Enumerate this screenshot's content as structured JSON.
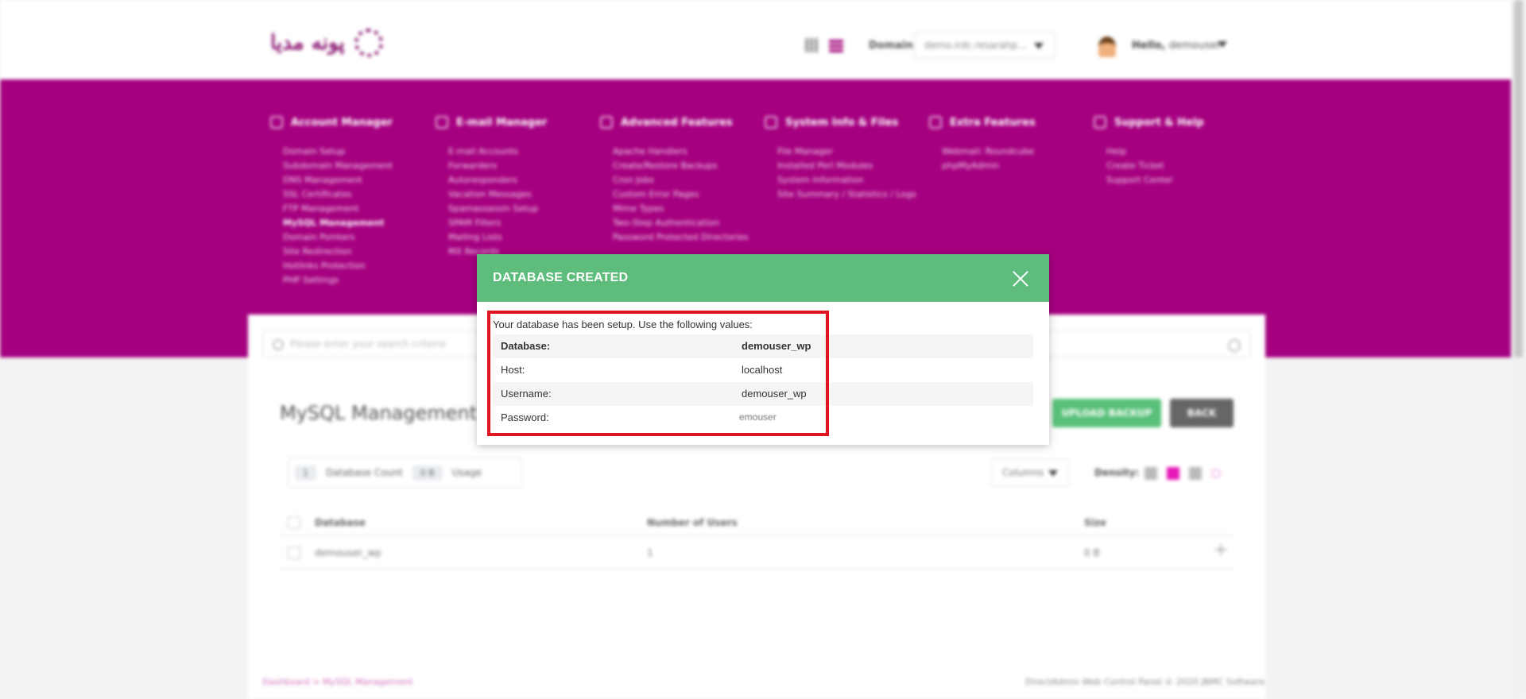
{
  "header": {
    "logo_text": "پونه مدیا",
    "domain_label": "Domain",
    "domain_value": "demo.irdc.resarahp...",
    "greeting": "Hello,",
    "username": "demouser"
  },
  "menu": [
    {
      "title": "Account Manager",
      "items": [
        "Domain Setup",
        "Subdomain Management",
        "DNS Management",
        "SSL Certificates",
        "FTP Management",
        "MySQL Management",
        "Domain Pointers",
        "Site Redirection",
        "Hotlinks Protection",
        "PHP Settings"
      ],
      "active": "MySQL Management"
    },
    {
      "title": "E-mail Manager",
      "items": [
        "E-mail Accounts",
        "Forwarders",
        "Autoresponders",
        "Vacation Messages",
        "Spamassassin Setup",
        "SPAM Filters",
        "Mailing Lists",
        "MX Records"
      ]
    },
    {
      "title": "Advanced Features",
      "items": [
        "Apache Handlers",
        "Create/Restore Backups",
        "Cron Jobs",
        "Custom Error Pages",
        "Mime Types",
        "Two-Step Authentication",
        "Password Protected Directories"
      ]
    },
    {
      "title": "System Info & Files",
      "items": [
        "File Manager",
        "Installed Perl Modules",
        "System Information",
        "Site Summary / Statistics / Logs"
      ]
    },
    {
      "title": "Extra Features",
      "items": [
        "Webmail: Roundcube",
        "phpMyAdmin"
      ]
    },
    {
      "title": "Support & Help",
      "items": [
        "Help",
        "Create Ticket",
        "Support Center"
      ]
    }
  ],
  "search": {
    "placeholder": "Please enter your search criteria"
  },
  "page": {
    "title": "MySQL Management",
    "upload_label": "UPLOAD BACKUP",
    "back_label": "BACK",
    "db_count": "1",
    "db_count_label": "Database Count",
    "usage": "0 B",
    "usage_label": "Usage",
    "columns_label": "Columns",
    "density_label": "Density:"
  },
  "table": {
    "headers": [
      "Database",
      "Number of Users",
      "Size"
    ],
    "rows": [
      {
        "database": "demouser_wp",
        "users": "1",
        "size": "0 B"
      }
    ]
  },
  "footer": {
    "breadcrumb": "Dashboard > MySQL Management",
    "copyright": "DirectAdmin Web Control Panel © 2020 JBMC Software"
  },
  "modal": {
    "title": "DATABASE CREATED",
    "intro": "Your database has been setup. Use the following values:",
    "rows": [
      {
        "label": "Database:",
        "value": "demouser_wp"
      },
      {
        "label": "Host:",
        "value": "localhost"
      },
      {
        "label": "Username:",
        "value": "demouser_wp"
      },
      {
        "label": "Password:",
        "value": "emouser"
      }
    ]
  },
  "colors": {
    "brand": "#a5007f",
    "modal_header": "#5ebd7c",
    "highlight": "#e0141e"
  }
}
